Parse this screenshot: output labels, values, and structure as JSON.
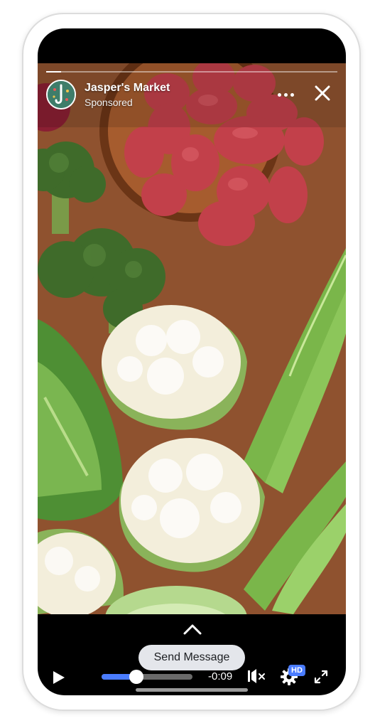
{
  "ad": {
    "advertiser": "Jasper's Market",
    "label": "Sponsored",
    "progress": 0.05
  },
  "icons": {
    "more": "more-icon",
    "close": "close-icon",
    "expand": "chevron-up-icon",
    "play": "play-icon",
    "mute": "mute-icon",
    "settings": "gear-icon",
    "fullscreen": "fullscreen-icon"
  },
  "cta": {
    "label": "Send Message"
  },
  "player": {
    "seek_position": 0.38,
    "time_remaining": "-0:09",
    "quality": "HD"
  },
  "colors": {
    "accent": "#4a7cff",
    "background": "#000000"
  }
}
